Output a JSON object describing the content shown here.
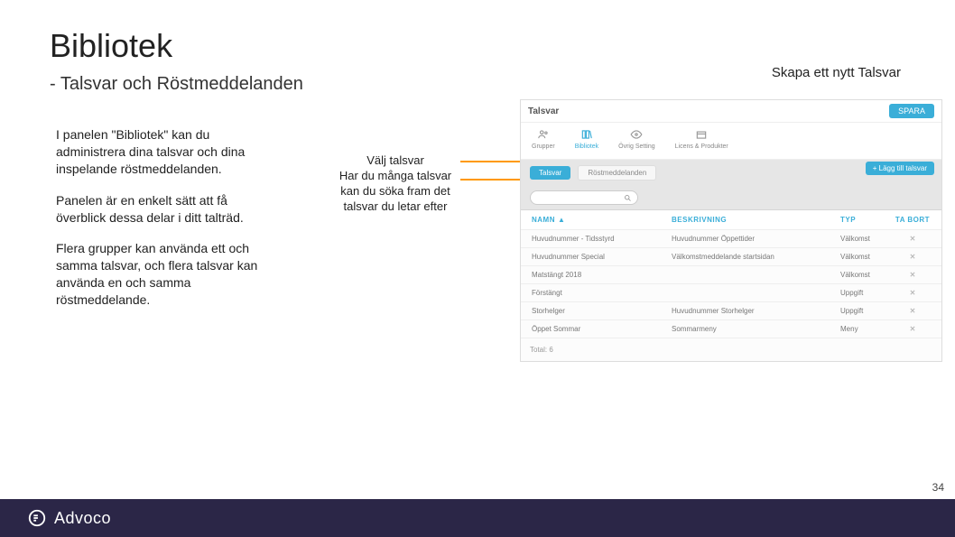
{
  "title": "Bibliotek",
  "subtitle": "- Talsvar och Röstmeddelanden",
  "topRight": "Skapa ett nytt Talsvar",
  "left": {
    "p1": "I panelen \"Bibliotek\" kan du administrera dina talsvar och dina inspelande röstmeddelanden.",
    "p2": "Panelen är en enkelt sätt att få överblick dessa delar i ditt talträd.",
    "p3": "Flera grupper kan använda ett och samma talsvar, och flera talsvar kan använda en och samma röstmeddelande."
  },
  "center": {
    "line1": "Välj talsvar",
    "line2": "Har du många talsvar kan du söka fram det talsvar du letar efter"
  },
  "mock": {
    "panelTitle": "Talsvar",
    "save": "SPARA",
    "topTabs": [
      "Grupper",
      "Bibliotek",
      "Övrig Setting",
      "Licens & Produkter"
    ],
    "subTabs": {
      "active": "Talsvar",
      "ghost": "Röstmeddelanden"
    },
    "addBtn": "+ Lägg till talsvar",
    "headers": {
      "name": "NAMN",
      "desc": "BESKRIVNING",
      "type": "TYP",
      "del": "TA BORT"
    },
    "rows": [
      {
        "name": "Huvudnummer - Tidsstyrd",
        "desc": "Huvudnummer Öppettider",
        "type": "Välkomst"
      },
      {
        "name": "Huvudnummer Special",
        "desc": "Välkomstmeddelande startsidan",
        "type": "Välkomst"
      },
      {
        "name": "Matstängt 2018",
        "desc": "",
        "type": "Välkomst"
      },
      {
        "name": "Förstängt",
        "desc": "",
        "type": "Uppgift"
      },
      {
        "name": "Storhelger",
        "desc": "Huvudnummer Storhelger",
        "type": "Uppgift"
      },
      {
        "name": "Öppet Sommar",
        "desc": "Sommarmeny",
        "type": "Meny"
      }
    ],
    "footer": "Total: 6"
  },
  "brand": "Advoco",
  "pageNumber": "34"
}
